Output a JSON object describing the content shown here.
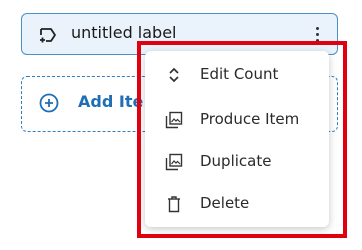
{
  "label_card": {
    "icon": "label-tag-icon",
    "text": "untitled label",
    "menu_icon": "kebab-menu-icon"
  },
  "add_card": {
    "icon": "add-circle-icon",
    "text": "Add Ite"
  },
  "context_menu": {
    "items": [
      {
        "label": "Edit Count",
        "icon": "unfold-arrows-icon"
      },
      {
        "label": "Produce Item",
        "icon": "image-stack-icon"
      },
      {
        "label": "Duplicate",
        "icon": "image-stack-icon"
      },
      {
        "label": "Delete",
        "icon": "trash-icon"
      }
    ]
  },
  "colors": {
    "accent": "#1e6fb5",
    "card_bg": "#eaf3fb",
    "highlight": "#e0000f"
  }
}
